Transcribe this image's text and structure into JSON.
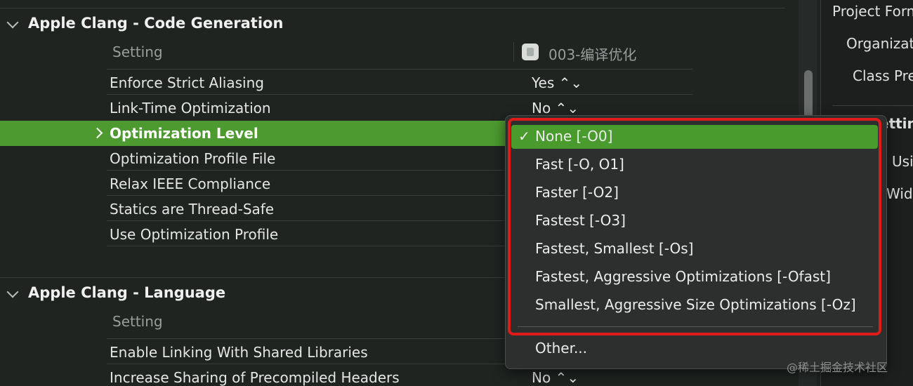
{
  "section1": {
    "title": "Apple Clang - Code Generation"
  },
  "section2": {
    "title": "Apple Clang - Language"
  },
  "header": {
    "setting": "Setting",
    "project": "003-编译优化"
  },
  "rows1": [
    {
      "label": "Enforce Strict Aliasing",
      "value": "Yes ⌃⌄"
    },
    {
      "label": "Link-Time Optimization",
      "value": "No ⌃⌄"
    },
    {
      "label": "Optimization Level",
      "value": ""
    },
    {
      "label": "Optimization Profile File",
      "value": ""
    },
    {
      "label": "Relax IEEE Compliance",
      "value": ""
    },
    {
      "label": "Statics are Thread-Safe",
      "value": ""
    },
    {
      "label": "Use Optimization Profile",
      "value": ""
    }
  ],
  "rows2": [
    {
      "label": "Enable Linking With Shared Libraries",
      "value": ""
    },
    {
      "label": "Increase Sharing of Precompiled Headers",
      "value": "No ⌃⌄"
    }
  ],
  "popup": {
    "checkmark": "✓",
    "items": [
      "None [-O0]",
      "Fast [-O, O1]",
      "Faster [-O2]",
      "Fastest [-O3]",
      "Fastest, Smallest [-Os]",
      "Fastest, Aggressive Optimizations [-Ofast]",
      "Smallest, Aggressive Size Optimizations [-Oz]"
    ],
    "other": "Other..."
  },
  "right_panel": {
    "project_format": "Project Form",
    "organization": "Organizat",
    "class_prefix": "Class Pre",
    "settings_frag": "ettin",
    "uses_frag": "Usi",
    "width_frag": "Widt"
  },
  "watermark": "@稀土掘金技术社区"
}
